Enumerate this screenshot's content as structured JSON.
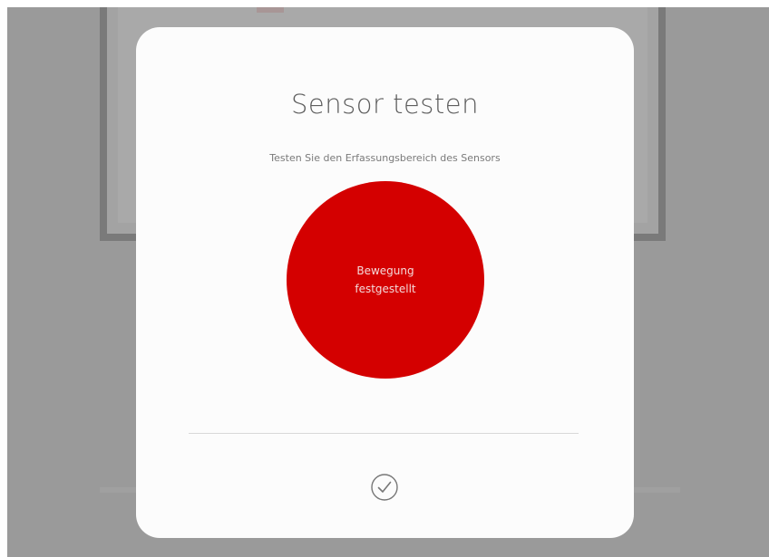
{
  "dialog": {
    "title": "Sensor testen",
    "subtitle": "Testen Sie den Erfassungsbereich des Sensors",
    "status": {
      "line1": "Bewegung",
      "line2": "festgestellt",
      "color": "#d40000"
    },
    "confirm_icon": "check-circle-icon"
  },
  "colors": {
    "accent": "#d40000",
    "overlay": "#9a9a9a",
    "dialog_background": "#fcfcfc"
  }
}
